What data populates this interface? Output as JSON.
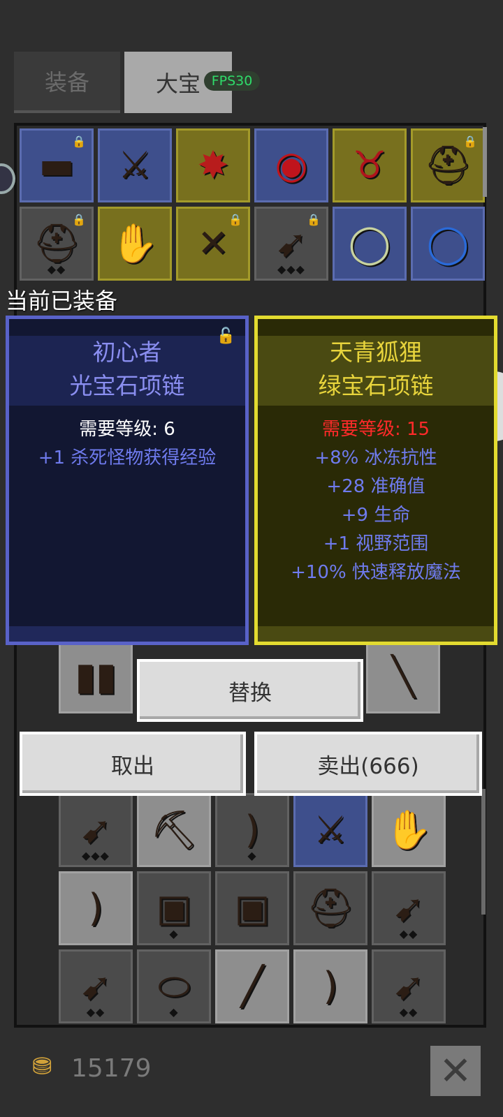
{
  "tabs": [
    {
      "label": "装备"
    },
    {
      "label": "大宝"
    }
  ],
  "fps_badge": "FPS30",
  "equipped_label": "当前已装备",
  "compare": {
    "current": {
      "prefix": "初心者",
      "name": "光宝石项链",
      "requirement": "需要等级: 6",
      "stats": [
        "+1 杀死怪物获得经验"
      ]
    },
    "candidate": {
      "prefix": "天青狐狸",
      "name": "绿宝石项链",
      "requirement": "需要等级: 15",
      "stats": [
        "+8% 冰冻抗性",
        "+28 准确值",
        "+9 生命",
        "+1 视野范围",
        "+10% 快速释放魔法"
      ]
    }
  },
  "buttons": {
    "replace": "替换",
    "take_out": "取出",
    "sell": "卖出(666)"
  },
  "gold": "15179",
  "colors": {
    "rarity_blue": "#5b6cb0",
    "rarity_yellow": "#e3db30",
    "requirement_unmet": "#ff2a2a",
    "stat_text": "#6f7bee"
  },
  "icons": {
    "lock": "lock-icon",
    "close": "close-icon",
    "gold": "gold-coins-icon"
  }
}
